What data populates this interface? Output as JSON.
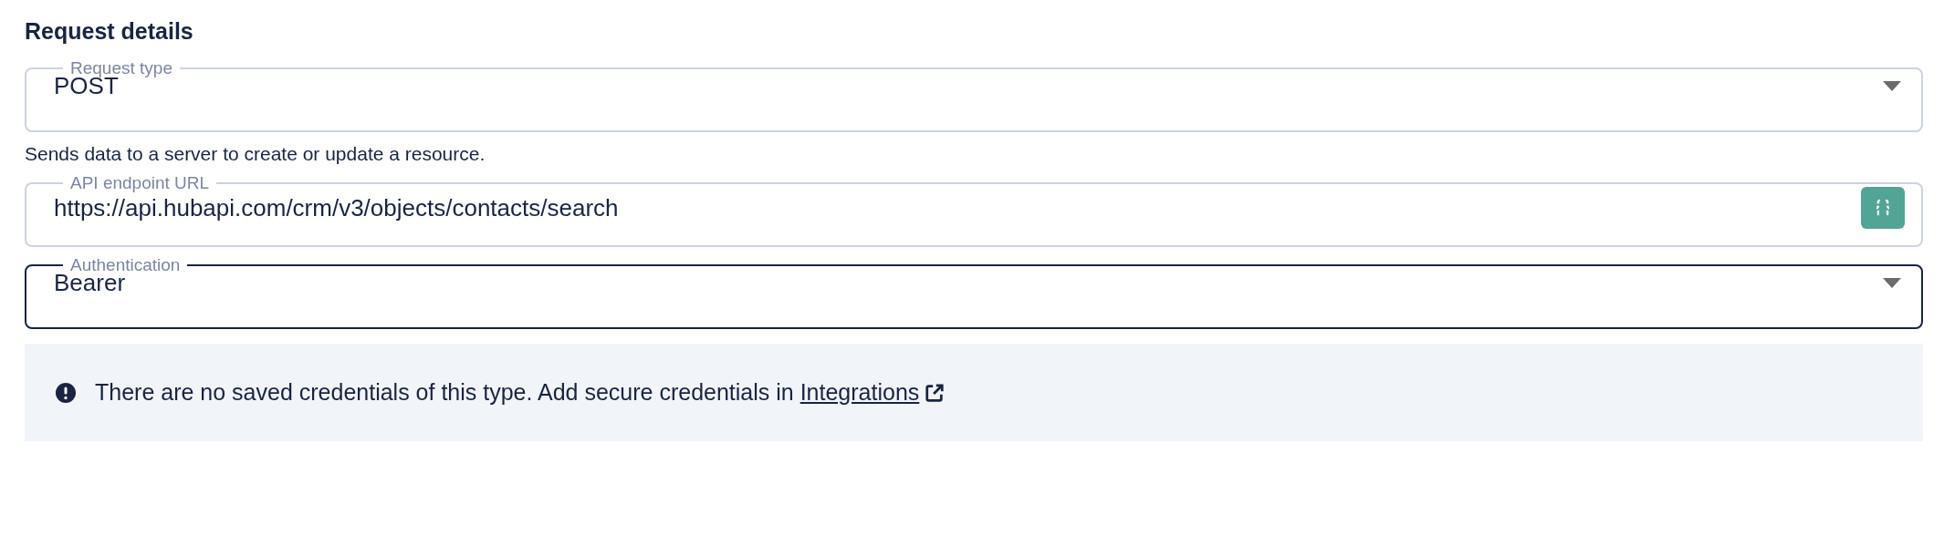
{
  "section": {
    "title": "Request details"
  },
  "fields": [
    {
      "kind": "select",
      "label": "Request type",
      "value": "POST",
      "focused": false,
      "helper": "Sends data to a server to create or update a resource."
    },
    {
      "kind": "text",
      "label": "API endpoint URL",
      "value": "https://api.hubapi.com/crm/v3/objects/contacts/search",
      "focused": false
    },
    {
      "kind": "select",
      "label": "Authentication",
      "value": "Bearer",
      "focused": true
    }
  ],
  "alert": {
    "text": "There are no saved credentials of this type. Add secure credentials in",
    "link": "Integrations"
  }
}
